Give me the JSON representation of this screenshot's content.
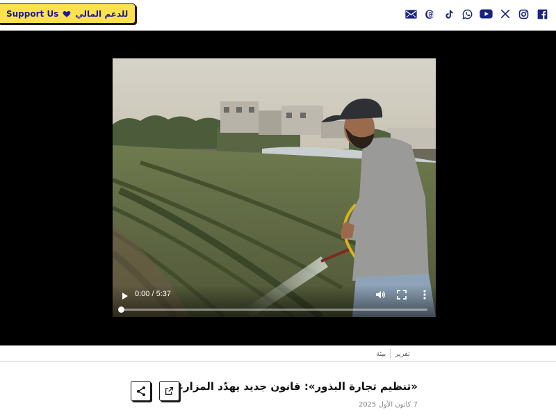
{
  "header": {
    "support_label_ar": "للدعم المالي",
    "support_label_en": "Support Us",
    "colors": {
      "support_bg": "#ffe14d",
      "support_text": "#1a1a9a",
      "social_icon": "#1a237e"
    },
    "social_icons": [
      "facebook-icon",
      "instagram-icon",
      "x-icon",
      "youtube-icon",
      "whatsapp-icon",
      "tiktok-icon",
      "threads-icon",
      "email-icon"
    ]
  },
  "video": {
    "time_display": "0:00 / 5:37",
    "progress": 0.0
  },
  "breadcrumbs": [
    "تقرير",
    "بيئة"
  ],
  "article": {
    "title": "«تنظيم تجارة البذور»: قانون جديد يهدّد المزارعين",
    "date": "7 كانون الأول 2025"
  }
}
